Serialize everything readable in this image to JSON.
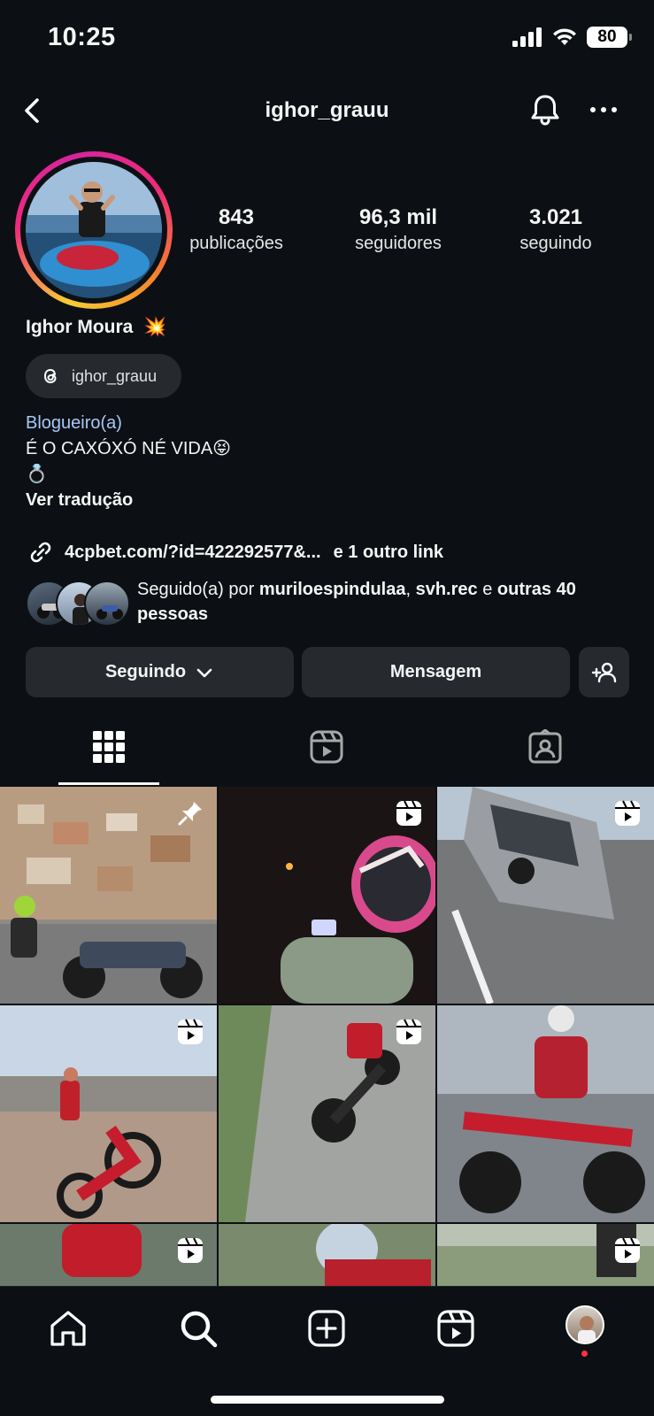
{
  "status": {
    "time": "10:25",
    "battery": "80"
  },
  "nav": {
    "username": "ighor_grauu"
  },
  "stats": [
    {
      "value": "843",
      "label": "publicações"
    },
    {
      "value": "96,3 mil",
      "label": "seguidores"
    },
    {
      "value": "3.021",
      "label": "seguindo"
    }
  ],
  "profile": {
    "name": "Ighor Moura",
    "name_emoji": "💥",
    "threads_handle": "ighor_grauu",
    "category": "Blogueiro(a)",
    "bio_line1": "É O CAXÓXÓ NÉ VIDA😝",
    "bio_line2": "💍",
    "see_translation": "Ver tradução",
    "link_text": "4cpbet.com/?id=422292577&...",
    "link_more": "e 1 outro link"
  },
  "followed_by": {
    "prefix": "Seguido(a) por",
    "user1": "muriloespindulaa",
    "sep": ",",
    "user2": "svh.rec",
    "and": "e",
    "others": "outras 40 pessoas"
  },
  "actions": {
    "following": "Seguindo",
    "message": "Mensagem"
  },
  "icons": {
    "grid_tab": "grid-icon",
    "reels_tab": "reels-icon",
    "tagged_tab": "tagged-icon"
  },
  "colors": {
    "background": "#0c1014",
    "button": "#262a2f",
    "category": "#a8c7fa",
    "notification_dot": "#ff3040"
  }
}
